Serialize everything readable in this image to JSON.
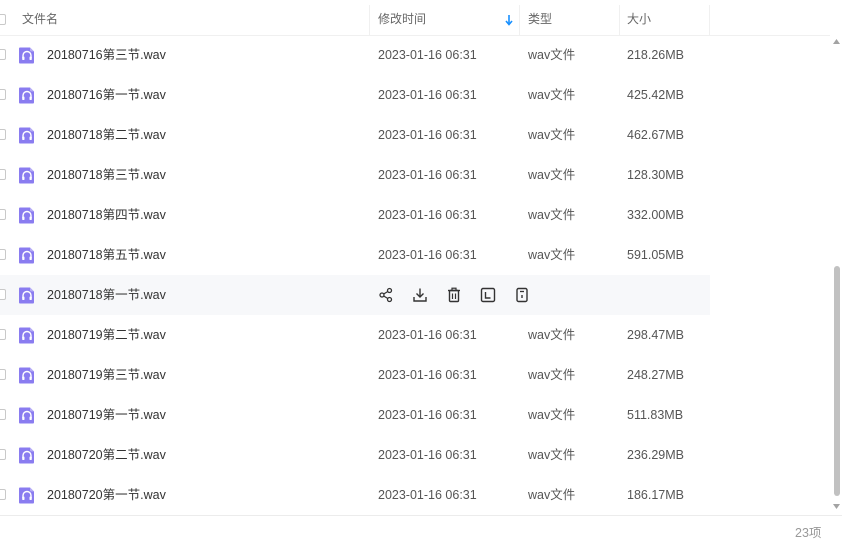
{
  "columns": {
    "name": "文件名",
    "modified": "修改时间",
    "type": "类型",
    "size": "大小"
  },
  "sort": {
    "column": "modified",
    "direction": "descending",
    "arrow_color": "#1890ff"
  },
  "icon_color": "#8a7cf0",
  "files": [
    {
      "name": "20180716第三节.wav",
      "date": "2023-01-16 06:31",
      "type": "wav文件",
      "size": "218.26MB"
    },
    {
      "name": "20180716第一节.wav",
      "date": "2023-01-16 06:31",
      "type": "wav文件",
      "size": "425.42MB"
    },
    {
      "name": "20180718第二节.wav",
      "date": "2023-01-16 06:31",
      "type": "wav文件",
      "size": "462.67MB"
    },
    {
      "name": "20180718第三节.wav",
      "date": "2023-01-16 06:31",
      "type": "wav文件",
      "size": "128.30MB"
    },
    {
      "name": "20180718第四节.wav",
      "date": "2023-01-16 06:31",
      "type": "wav文件",
      "size": "332.00MB"
    },
    {
      "name": "20180718第五节.wav",
      "date": "2023-01-16 06:31",
      "type": "wav文件",
      "size": "591.05MB"
    },
    {
      "name": "20180718第一节.wav",
      "hovered": true,
      "actions": [
        "share-icon",
        "download-icon",
        "delete-icon",
        "rename-icon",
        "more-icon"
      ]
    },
    {
      "name": "20180719第二节.wav",
      "date": "2023-01-16 06:31",
      "type": "wav文件",
      "size": "298.47MB"
    },
    {
      "name": "20180719第三节.wav",
      "date": "2023-01-16 06:31",
      "type": "wav文件",
      "size": "248.27MB"
    },
    {
      "name": "20180719第一节.wav",
      "date": "2023-01-16 06:31",
      "type": "wav文件",
      "size": "511.83MB"
    },
    {
      "name": "20180720第二节.wav",
      "date": "2023-01-16 06:31",
      "type": "wav文件",
      "size": "236.29MB"
    },
    {
      "name": "20180720第一节.wav",
      "date": "2023-01-16 06:31",
      "type": "wav文件",
      "size": "186.17MB"
    }
  ],
  "footer": {
    "count": "23项"
  }
}
